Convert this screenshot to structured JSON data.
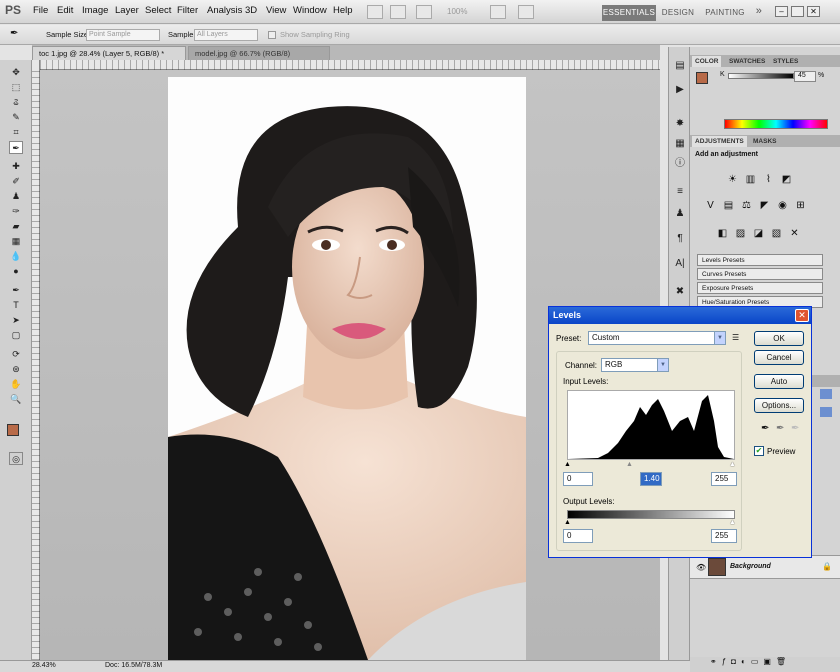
{
  "app": {
    "logo": "PS"
  },
  "menu": [
    "File",
    "Edit",
    "Image",
    "Layer",
    "Select",
    "Filter",
    "Analysis",
    "3D",
    "View",
    "Window",
    "Help"
  ],
  "toolbar": {
    "zoom": "100%"
  },
  "workspace": {
    "essentials": "ESSENTIALS",
    "design": "DESIGN",
    "painting": "PAINTING",
    "more": "»"
  },
  "options": {
    "sample_size_label": "Sample Size:",
    "sample_size_value": "Point Sample",
    "sample_label": "Sample:",
    "sample_value": "All Layers",
    "show_ring": "Show Sampling Ring"
  },
  "tabs": [
    {
      "label": "toc 1.jpg @ 28.4% (Layer 5, RGB/8) *"
    },
    {
      "label": "model.jpg @ 66.7% (RGB/8)"
    }
  ],
  "status": {
    "zoom": "28.43%",
    "doc": "Doc: 16.5M/78.3M"
  },
  "colors": {
    "foreground": "#b86a48",
    "background": "#ffffff",
    "dialog_title": "#0a45c8"
  },
  "color_panel": {
    "tabs": [
      "COLOR",
      "SWATCHES",
      "STYLES"
    ],
    "channel": "K",
    "value": "45",
    "unit": "%"
  },
  "adjustments": {
    "tabs": [
      "ADJUSTMENTS",
      "MASKS"
    ],
    "heading": "Add an adjustment",
    "presets": [
      "Levels Presets",
      "Curves Presets",
      "Exposure Presets",
      "Hue/Saturation Presets"
    ]
  },
  "layers": {
    "background": "Background"
  },
  "levels": {
    "title": "Levels",
    "preset_label": "Preset:",
    "preset_value": "Custom",
    "channel_label": "Channel:",
    "channel_value": "RGB",
    "input_label": "Input Levels:",
    "input": [
      "0",
      "1.40",
      "255"
    ],
    "output_label": "Output Levels:",
    "output": [
      "0",
      "255"
    ],
    "buttons": {
      "ok": "OK",
      "cancel": "Cancel",
      "auto": "Auto",
      "options": "Options..."
    },
    "preview_label": "Preview",
    "preview_checked": true
  }
}
